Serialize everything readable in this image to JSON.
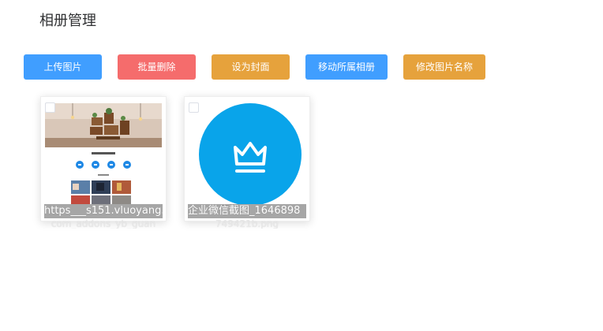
{
  "page": {
    "title": "相册管理"
  },
  "toolbar": {
    "upload_label": "上传图片",
    "batch_delete_label": "批量删除",
    "set_cover_label": "设为封面",
    "move_album_label": "移动所属相册",
    "rename_label": "修改图片名称"
  },
  "colors": {
    "primary": "#409eff",
    "danger": "#f56c6c",
    "warning": "#e6a23c",
    "crown_circle": "#09a4ea"
  },
  "photos": [
    {
      "filename_visible": "https___s151.vluoyang.",
      "filename_overflow": "com_addons_yb_guan",
      "checked": false,
      "thumbnail": "webpage-screenshot-with-shelf-photo"
    },
    {
      "filename_visible": "企业微信截图_1646898",
      "filename_overflow": "749421b.png",
      "checked": false,
      "thumbnail": "crown-icon-blue-circle"
    }
  ]
}
